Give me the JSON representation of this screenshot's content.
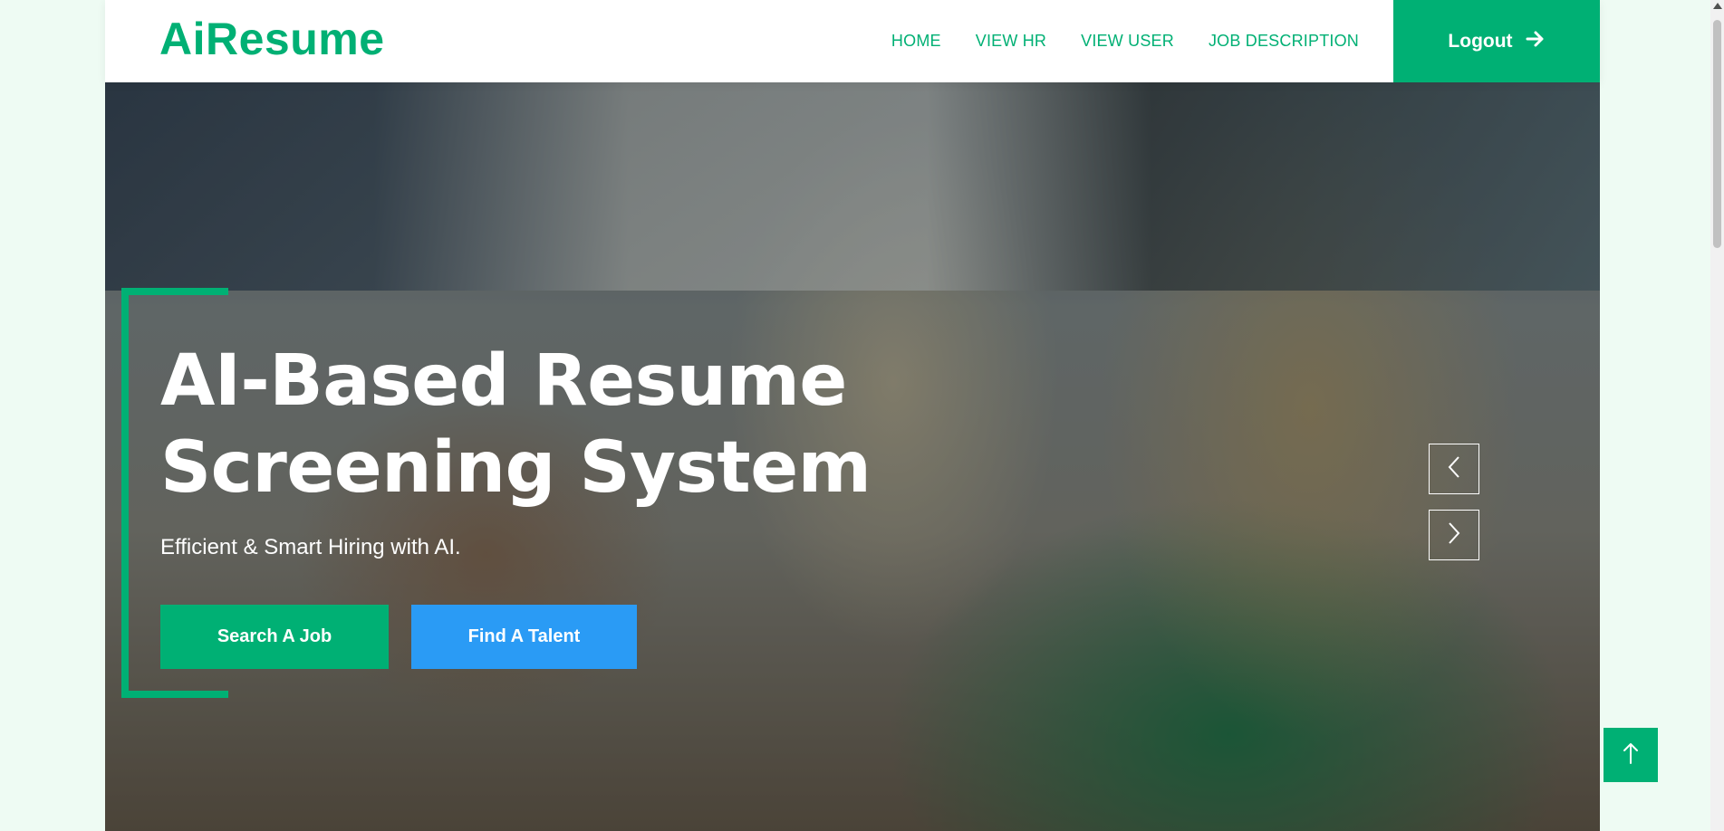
{
  "navbar": {
    "brand": "AiResume",
    "links": [
      "HOME",
      "VIEW HR",
      "VIEW USER",
      "JOB DESCRIPTION"
    ],
    "logout_label": "Logout",
    "logout_icon": "arrow-right-icon"
  },
  "hero": {
    "title": "AI-Based Resume Screening System",
    "subtitle": "Efficient & Smart Hiring with AI.",
    "primary_button": "Search A Job",
    "secondary_button": "Find A Talent",
    "image": "office-two-women-photo"
  },
  "carousel": {
    "prev_icon": "chevron-left-icon",
    "next_icon": "chevron-right-icon"
  },
  "back_to_top": {
    "icon": "arrow-up-icon"
  },
  "colors": {
    "accent": "#00b074",
    "secondary": "#2a9bf5",
    "page_bg": "#eefbf3"
  }
}
